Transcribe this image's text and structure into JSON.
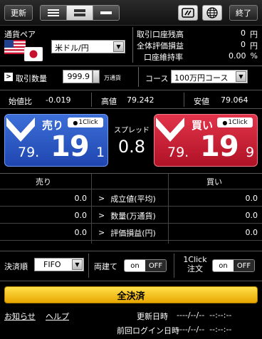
{
  "topbar": {
    "update_label": "更新",
    "exit_label": "終了",
    "layout_options": [
      "list-layout",
      "split-layout",
      "single-layout"
    ]
  },
  "pair": {
    "label": "通貨ペア",
    "selected": "米ドル/円"
  },
  "account": [
    {
      "label": "取引口座残高",
      "value": "0",
      "unit": "円"
    },
    {
      "label": "全体評価損益",
      "value": "0",
      "unit": "円"
    },
    {
      "label": "口座維持率",
      "value": "0.00",
      "unit": "%"
    }
  ],
  "order": {
    "qty_label": "取引数量",
    "qty_value": "999.9",
    "qty_unit": "万通貨",
    "course_label": "コース",
    "course_value": "100万円コース"
  },
  "stats": {
    "change_label": "始値比",
    "change_value": "-0.019",
    "high_label": "高値",
    "high_value": "79.242",
    "low_label": "安値",
    "low_value": "79.064"
  },
  "sell": {
    "title": "売り",
    "oneclick": "1Click",
    "price_prefix": "79.",
    "price_big": "19",
    "price_last": "1"
  },
  "buy": {
    "title": "買い",
    "oneclick": "1Click",
    "price_prefix": "79.",
    "price_big": "19",
    "price_last": "9"
  },
  "spread": {
    "label": "スプレッド",
    "value": "0.8"
  },
  "positions": {
    "sell_header": "売り",
    "buy_header": "買い",
    "rows": [
      {
        "label": "成立値(平均)",
        "sell": "0.0",
        "buy": "0.0"
      },
      {
        "label": "数量(万通貨)",
        "sell": "0.0",
        "buy": "0.0"
      },
      {
        "label": "評価損益(円)",
        "sell": "0.0",
        "buy": "0.0"
      }
    ]
  },
  "settings": {
    "settle_label": "決済順",
    "settle_value": "FIFO",
    "hedge_label": "両建て",
    "hedge_on": "on",
    "hedge_off": "OFF",
    "oneclick_label_1": "1Click",
    "oneclick_label_2": "注文",
    "oneclick_on": "on",
    "oneclick_off": "OFF"
  },
  "close_all_label": "全決済",
  "footer": {
    "notice_link": "お知らせ",
    "help_link": "ヘルプ",
    "update_time_label": "更新日時",
    "update_time_value": "----/--/--  --:--:--",
    "last_login_label": "前回ログイン日時",
    "last_login_value": "----/--/--  --:--:--"
  },
  "colors": {
    "sell_blue": "#2a56c6",
    "buy_red": "#c91d33",
    "close_all_yellow": "#f5c518"
  }
}
